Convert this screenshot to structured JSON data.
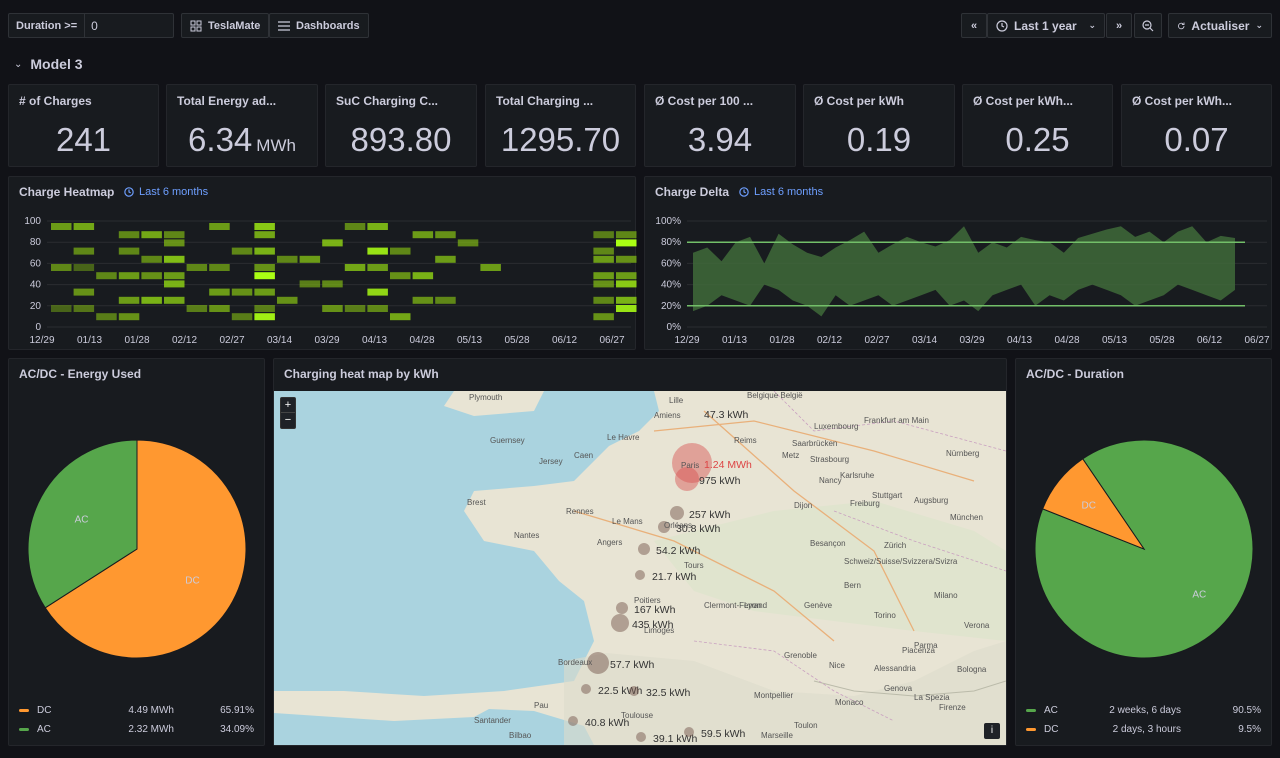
{
  "toolbar": {
    "duration_label": "Duration >=",
    "duration_value": "0",
    "teslamate_label": "TeslaMate",
    "dashboards_label": "Dashboards",
    "time_range": "Last 1 year",
    "refresh_label": "Actualiser"
  },
  "row": {
    "title": "Model 3"
  },
  "stats": [
    {
      "title": "# of Charges",
      "value": "241",
      "unit": ""
    },
    {
      "title": "Total Energy ad...",
      "value": "6.34",
      "unit": "MWh"
    },
    {
      "title": "SuC Charging C...",
      "value": "893.80",
      "unit": ""
    },
    {
      "title": "Total Charging ...",
      "value": "1295.70",
      "unit": ""
    },
    {
      "title": "Ø Cost per 100 ...",
      "value": "3.94",
      "unit": ""
    },
    {
      "title": "Ø Cost per kWh",
      "value": "0.19",
      "unit": ""
    },
    {
      "title": "Ø Cost per kWh...",
      "value": "0.25",
      "unit": ""
    },
    {
      "title": "Ø Cost per kWh...",
      "value": "0.07",
      "unit": ""
    }
  ],
  "heatmap": {
    "title": "Charge Heatmap",
    "badge": "Last 6 months",
    "y_ticks": [
      "0",
      "20",
      "40",
      "60",
      "80",
      "100"
    ],
    "x_ticks": [
      "12/29",
      "01/13",
      "01/28",
      "02/12",
      "02/27",
      "03/14",
      "03/29",
      "04/13",
      "04/28",
      "05/13",
      "05/28",
      "06/12",
      "06/27"
    ]
  },
  "delta": {
    "title": "Charge Delta",
    "badge": "Last 6 months",
    "y_ticks": [
      "0%",
      "20%",
      "40%",
      "60%",
      "80%",
      "100%"
    ],
    "x_ticks": [
      "12/29",
      "01/13",
      "01/28",
      "02/12",
      "02/27",
      "03/14",
      "03/29",
      "04/13",
      "04/28",
      "05/13",
      "05/28",
      "06/12",
      "06/27"
    ],
    "threshold_low": 20,
    "threshold_high": 80
  },
  "energy_pie": {
    "title": "AC/DC - Energy Used",
    "slices": [
      {
        "name": "DC",
        "value": 4.49,
        "display": "4.49 MWh",
        "percent": "65.91%",
        "color": "#ff9830"
      },
      {
        "name": "AC",
        "value": 2.32,
        "display": "2.32 MWh",
        "percent": "34.09%",
        "color": "#56a64b"
      }
    ]
  },
  "map": {
    "title": "Charging heat map by kWh",
    "zoom_in": "+",
    "zoom_out": "−",
    "info": "i",
    "labels": [
      {
        "text": "47.3 kWh"
      },
      {
        "text": "1.24 MWh"
      },
      {
        "text": "975 kWh"
      },
      {
        "text": "257 kWh"
      },
      {
        "text": "30.8 kWh"
      },
      {
        "text": "54.2 kWh"
      },
      {
        "text": "21.7 kWh"
      },
      {
        "text": "167 kWh"
      },
      {
        "text": "435 kWh"
      },
      {
        "text": "57.7 kWh"
      },
      {
        "text": "22.5 kWh"
      },
      {
        "text": "32.5 kWh"
      },
      {
        "text": "40.8 kWh"
      },
      {
        "text": "39.1 kWh"
      },
      {
        "text": "59.5 kWh"
      }
    ],
    "cities": [
      "Paris",
      "Rennes",
      "Le Mans",
      "Angers",
      "Bordeaux",
      "Toulouse",
      "Marseille",
      "Genova",
      "Bologna",
      "Firenze",
      "Monaco",
      "Strasbourg",
      "Frankfurt am Main",
      "Nürnberg",
      "München",
      "Brest",
      "Plymouth",
      "Guernsey",
      "Jersey",
      "Le Havre",
      "Belgique België",
      "Luxembourg",
      "Besançon",
      "Schweiz/Suisse/Svizzera/Svizra",
      "Grenoble",
      "Torino",
      "Milano",
      "Clermont-Ferrand",
      "Limoges",
      "Poitiers",
      "Tours",
      "Santander",
      "Bilbao",
      "Lyon",
      "Dijon",
      "Nancy",
      "Reims",
      "Orléans",
      "Stuttgart",
      "Freiburg",
      "Augsburg",
      "Zürich",
      "Bern",
      "Genève",
      "Verona",
      "Parma",
      "La Spezia",
      "Alessandria",
      "Piacenza",
      "Pau",
      "Montpellier",
      "Nice",
      "Toulon",
      "Nantes",
      "Caen",
      "Amiens",
      "Lille",
      "Saarbrücken",
      "Karlsruhe",
      "Metz"
    ]
  },
  "duration_pie": {
    "title": "AC/DC - Duration",
    "slices": [
      {
        "name": "AC",
        "value": 90.5,
        "display": "2 weeks, 6 days",
        "percent": "90.5%",
        "color": "#56a64b"
      },
      {
        "name": "DC",
        "value": 9.5,
        "display": "2 days, 3 hours",
        "percent": "9.5%",
        "color": "#ff9830"
      }
    ]
  }
}
